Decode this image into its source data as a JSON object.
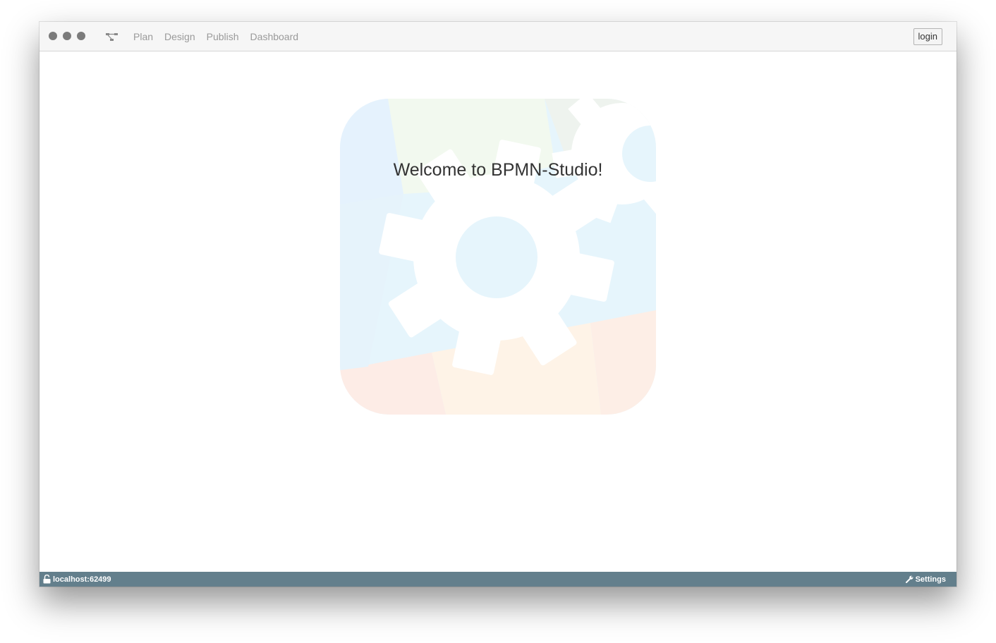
{
  "window": {
    "traffic_lights": [
      "close",
      "minimize",
      "maximize"
    ],
    "app_icon": "process-tree-icon"
  },
  "nav": {
    "items": [
      {
        "label": "Plan"
      },
      {
        "label": "Design"
      },
      {
        "label": "Publish"
      },
      {
        "label": "Dashboard"
      }
    ]
  },
  "header": {
    "login_label": "login"
  },
  "main": {
    "welcome_text": "Welcome to BPMN-Studio!",
    "logo_icon": "bpmn-studio-gear-logo"
  },
  "statusbar": {
    "connection_icon": "unlock-icon",
    "host": "localhost:62499",
    "settings_icon": "wrench-icon",
    "settings_label": "Settings",
    "background_color": "#637f8c"
  }
}
